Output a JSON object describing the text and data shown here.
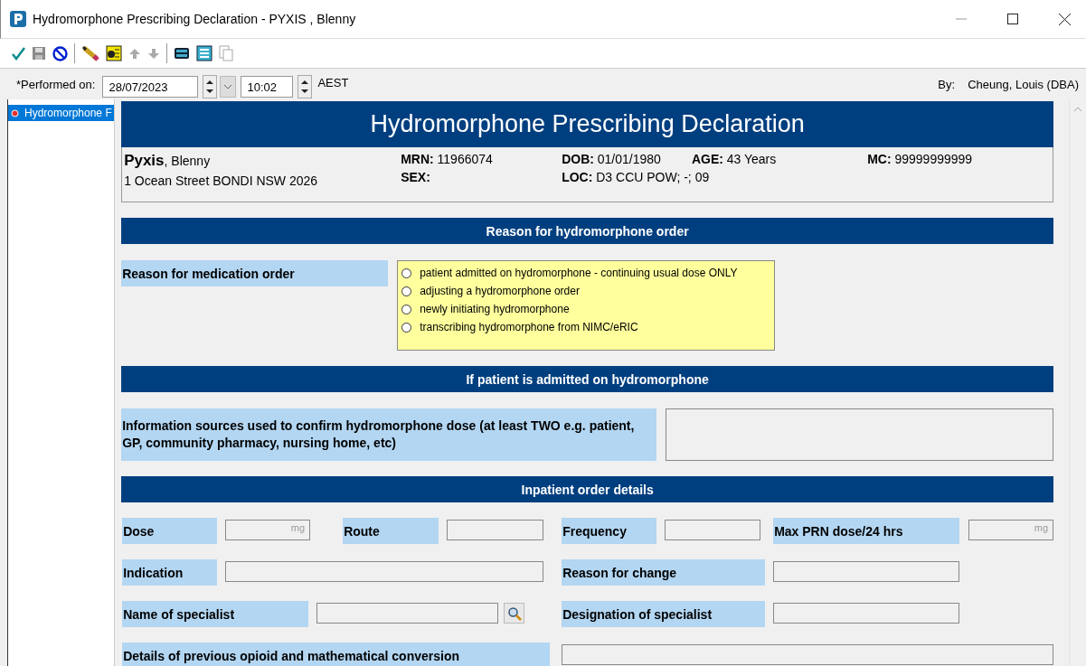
{
  "window": {
    "title": "Hydromorphone Prescribing Declaration - PYXIS , Blenny"
  },
  "performed": {
    "label": "*Performed on:",
    "date": "28/07/2023",
    "time": "10:02",
    "timezone": "AEST",
    "by_label": "By:",
    "by_value": "Cheung, Louis (DBA)"
  },
  "sidebar": {
    "items": [
      {
        "label": "Hydromorphone F",
        "selected": true
      }
    ]
  },
  "form": {
    "title": "Hydromorphone Prescribing Declaration",
    "patient": {
      "surname": "Pyxis",
      "given": ", Blenny",
      "address": "1 Ocean Street BONDI NSW 2026",
      "mrn_label": "MRN:",
      "mrn": "11966074",
      "sex_label": "SEX:",
      "dob_label": "DOB:",
      "dob": "01/01/1980",
      "age_label": "AGE:",
      "age": "43 Years",
      "loc_label": "LOC:",
      "loc": "D3 CCU POW; -; 09",
      "mc_label": "MC:",
      "mc": "99999999999"
    },
    "sections": [
      {
        "title": "Reason for hydromorphone order",
        "question": "Reason for medication order",
        "options": [
          {
            "label": "patient admitted on hydromorphone - continuing usual dose ONLY",
            "selected": false
          },
          {
            "label": "adjusting a hydromorphone order",
            "selected": false
          },
          {
            "label": "newly initiating hydromorphone",
            "selected": false
          },
          {
            "label": "transcribing hydromorphone from NIMC/eRIC",
            "selected": false
          }
        ]
      },
      {
        "title": "If patient is admitted on hydromorphone",
        "question": "Information sources used to confirm hydromorphone dose (at least TWO e.g. patient, GP, community pharmacy, nursing home, etc)"
      },
      {
        "title": "Inpatient order details",
        "rows": [
          {
            "items": [
              {
                "kind": "label",
                "text": "Dose"
              },
              {
                "kind": "input",
                "unit": "mg"
              },
              {
                "kind": "label",
                "text": "Route"
              },
              {
                "kind": "input"
              },
              {
                "kind": "label",
                "text": "Frequency"
              },
              {
                "kind": "input"
              },
              {
                "kind": "label",
                "text": "Max PRN dose/24 hrs"
              },
              {
                "kind": "input",
                "unit": "mg"
              }
            ]
          },
          {
            "items": [
              {
                "kind": "label",
                "text": "Indication"
              },
              {
                "kind": "input"
              },
              {
                "kind": "label",
                "text": "Reason for change"
              },
              {
                "kind": "input"
              }
            ]
          },
          {
            "items": [
              {
                "kind": "label",
                "text": "Name of specialist"
              },
              {
                "kind": "input"
              },
              {
                "kind": "lookup"
              },
              {
                "kind": "label",
                "text": "Designation of specialist"
              },
              {
                "kind": "input"
              }
            ]
          },
          {
            "items": [
              {
                "kind": "label",
                "text": "Details of previous opioid and mathematical conversion"
              },
              {
                "kind": "input"
              }
            ]
          }
        ]
      }
    ]
  }
}
